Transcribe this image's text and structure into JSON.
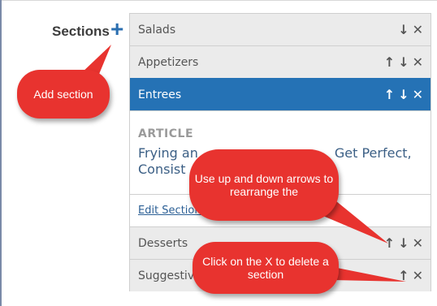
{
  "header": {
    "sections_label": "Sections",
    "add_icon": "+"
  },
  "sections": [
    {
      "label": "Salads",
      "controls": "↓✕"
    },
    {
      "label": "Appetizers",
      "controls": "↑↓✕"
    },
    {
      "label": "Entrees",
      "controls": "↑↓✕"
    },
    {
      "label": "Desserts",
      "controls": "↑↓✕"
    },
    {
      "label": "Suggestive",
      "controls": "↑✕"
    }
  ],
  "detail": {
    "tag": "ARTICLE",
    "title_line1": "Frying an",
    "title_line1_tail": "Get Perfect,",
    "title_line2": "Consist",
    "edit_link": "Edit Section"
  },
  "callouts": {
    "add": "Add section",
    "arrows": "Use up and down arrows to rearrange the",
    "delete": "Click on the X to delete a section"
  },
  "colors": {
    "active_row": "#2572b5",
    "callout": "#e8332f",
    "add_icon": "#2b6fb0"
  }
}
